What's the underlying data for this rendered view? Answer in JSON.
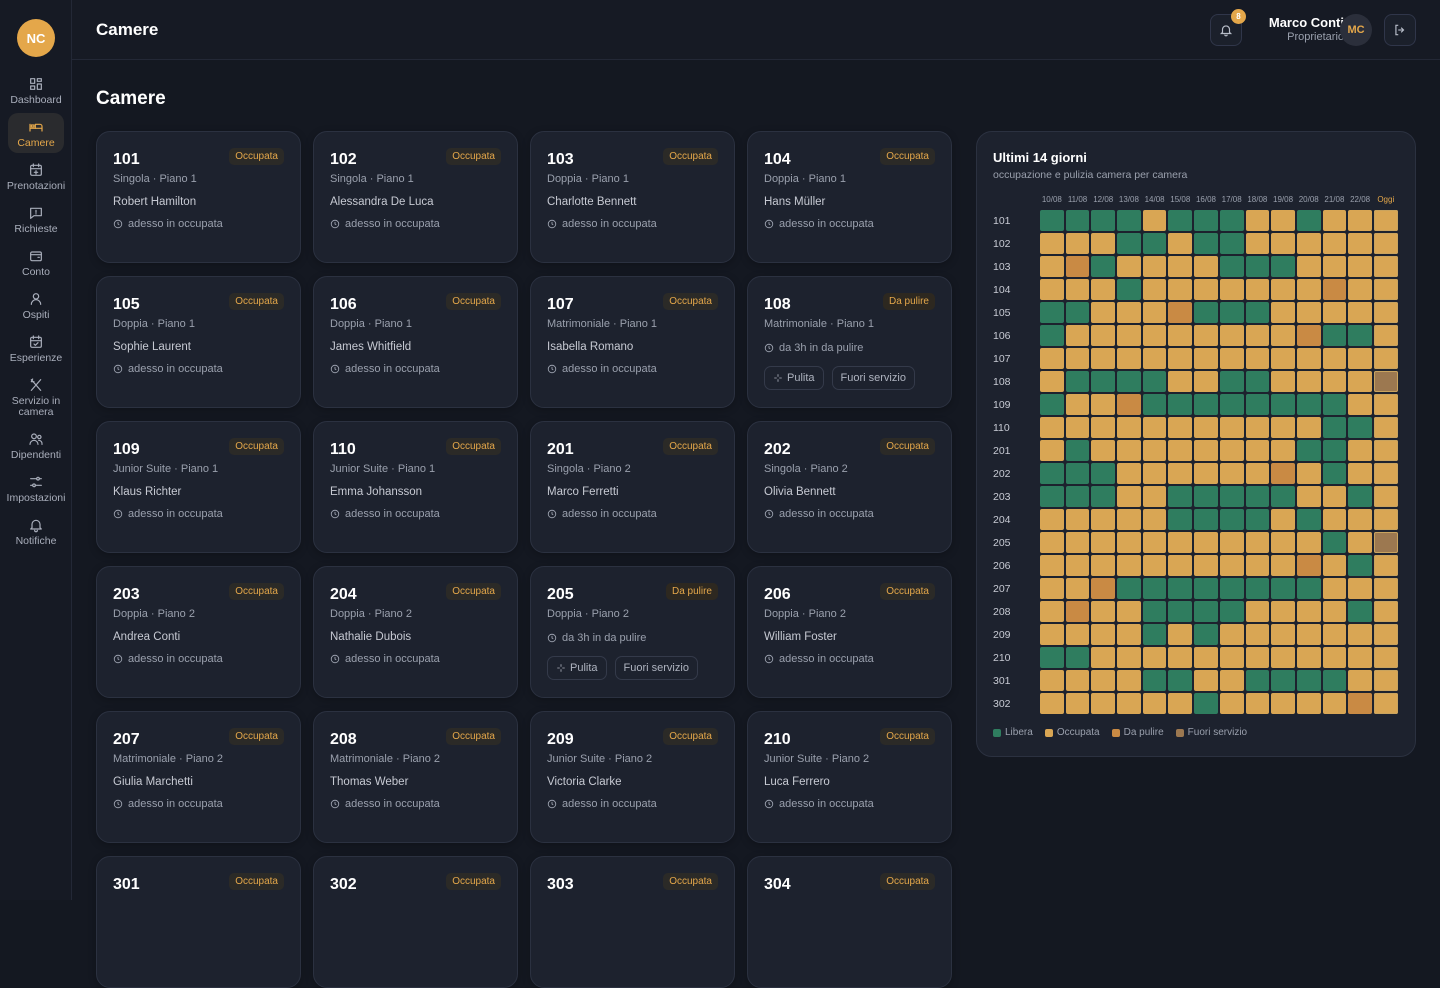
{
  "app": {
    "logo": "NC",
    "header_title": "Camere",
    "page_title": "Camere"
  },
  "user": {
    "name": "Marco Conti",
    "role": "Proprietario",
    "initials": "MC",
    "notifications": "8"
  },
  "nav": [
    {
      "label": "Dashboard",
      "icon": "dashboard-icon"
    },
    {
      "label": "Camere",
      "icon": "bed-icon",
      "active": true
    },
    {
      "label": "Prenotazioni",
      "icon": "calendar-plus-icon"
    },
    {
      "label": "Richieste",
      "icon": "message-icon"
    },
    {
      "label": "Conto",
      "icon": "wallet-icon"
    },
    {
      "label": "Ospiti",
      "icon": "user-icon"
    },
    {
      "label": "Esperienze",
      "icon": "calendar-check-icon"
    },
    {
      "label": "Servizio in camera",
      "icon": "cutlery-icon"
    },
    {
      "label": "Dipendenti",
      "icon": "users-icon"
    },
    {
      "label": "Impostazioni",
      "icon": "sliders-icon"
    },
    {
      "label": "Notifiche",
      "icon": "bell-icon"
    }
  ],
  "rooms": [
    {
      "number": "101",
      "type": "Singola · Piano 1",
      "status": "Occupata",
      "guest": "Robert Hamilton",
      "since": "adesso in occupata"
    },
    {
      "number": "102",
      "type": "Singola · Piano 1",
      "status": "Occupata",
      "guest": "Alessandra De Luca",
      "since": "adesso in occupata"
    },
    {
      "number": "103",
      "type": "Doppia · Piano 1",
      "status": "Occupata",
      "guest": "Charlotte Bennett",
      "since": "adesso in occupata"
    },
    {
      "number": "104",
      "type": "Doppia · Piano 1",
      "status": "Occupata",
      "guest": "Hans Müller",
      "since": "adesso in occupata"
    },
    {
      "number": "105",
      "type": "Doppia · Piano 1",
      "status": "Occupata",
      "guest": "Sophie Laurent",
      "since": "adesso in occupata"
    },
    {
      "number": "106",
      "type": "Doppia · Piano 1",
      "status": "Occupata",
      "guest": "James Whitfield",
      "since": "adesso in occupata"
    },
    {
      "number": "107",
      "type": "Matrimoniale · Piano 1",
      "status": "Occupata",
      "guest": "Isabella Romano",
      "since": "adesso in occupata"
    },
    {
      "number": "108",
      "type": "Matrimoniale · Piano 1",
      "status": "Da pulire",
      "guest": "",
      "since": "da 3h in da pulire",
      "actions": [
        "Pulita",
        "Fuori servizio"
      ]
    },
    {
      "number": "109",
      "type": "Junior Suite · Piano 1",
      "status": "Occupata",
      "guest": "Klaus Richter",
      "since": "adesso in occupata"
    },
    {
      "number": "110",
      "type": "Junior Suite · Piano 1",
      "status": "Occupata",
      "guest": "Emma Johansson",
      "since": "adesso in occupata"
    },
    {
      "number": "201",
      "type": "Singola · Piano 2",
      "status": "Occupata",
      "guest": "Marco Ferretti",
      "since": "adesso in occupata"
    },
    {
      "number": "202",
      "type": "Singola · Piano 2",
      "status": "Occupata",
      "guest": "Olivia Bennett",
      "since": "adesso in occupata"
    },
    {
      "number": "203",
      "type": "Doppia · Piano 2",
      "status": "Occupata",
      "guest": "Andrea Conti",
      "since": "adesso in occupata"
    },
    {
      "number": "204",
      "type": "Doppia · Piano 2",
      "status": "Occupata",
      "guest": "Nathalie Dubois",
      "since": "adesso in occupata"
    },
    {
      "number": "205",
      "type": "Doppia · Piano 2",
      "status": "Da pulire",
      "guest": "",
      "since": "da 3h in da pulire",
      "actions": [
        "Pulita",
        "Fuori servizio"
      ]
    },
    {
      "number": "206",
      "type": "Doppia · Piano 2",
      "status": "Occupata",
      "guest": "William Foster",
      "since": "adesso in occupata"
    },
    {
      "number": "207",
      "type": "Matrimoniale · Piano 2",
      "status": "Occupata",
      "guest": "Giulia Marchetti",
      "since": "adesso in occupata"
    },
    {
      "number": "208",
      "type": "Matrimoniale · Piano 2",
      "status": "Occupata",
      "guest": "Thomas Weber",
      "since": "adesso in occupata"
    },
    {
      "number": "209",
      "type": "Junior Suite · Piano 2",
      "status": "Occupata",
      "guest": "Victoria Clarke",
      "since": "adesso in occupata"
    },
    {
      "number": "210",
      "type": "Junior Suite · Piano 2",
      "status": "Occupata",
      "guest": "Luca Ferrero",
      "since": "adesso in occupata"
    },
    {
      "number": "301",
      "type": "",
      "status": "Occupata",
      "guest": "",
      "since": ""
    },
    {
      "number": "302",
      "type": "",
      "status": "Occupata",
      "guest": "",
      "since": ""
    },
    {
      "number": "303",
      "type": "",
      "status": "Occupata",
      "guest": "",
      "since": ""
    },
    {
      "number": "304",
      "type": "",
      "status": "Occupata",
      "guest": "",
      "since": ""
    }
  ],
  "history": {
    "title": "Ultimi 14 giorni",
    "subtitle": "occupazione e pulizia camera per camera",
    "dates": [
      "10/08",
      "11/08",
      "12/08",
      "13/08",
      "14/08",
      "15/08",
      "16/08",
      "17/08",
      "18/08",
      "19/08",
      "20/08",
      "21/08",
      "22/08",
      "Oggi"
    ],
    "colors": {
      "L": "#2f7d5f",
      "O": "#d9a654",
      "D": "#c98a44",
      "F": "#9c7850"
    },
    "legend": [
      {
        "label": "Libera",
        "key": "L"
      },
      {
        "label": "Occupata",
        "key": "O"
      },
      {
        "label": "Da pulire",
        "key": "D"
      },
      {
        "label": "Fuori servizio",
        "key": "F"
      }
    ],
    "rows": [
      {
        "room": "101",
        "cells": "LLLLOLLLOOLOOO"
      },
      {
        "room": "102",
        "cells": "OOOLLOLLOOOOOO"
      },
      {
        "room": "103",
        "cells": "ODLOOOOLLLOOOO"
      },
      {
        "room": "104",
        "cells": "OOOLOOOOOOODOO"
      },
      {
        "room": "105",
        "cells": "LLOOODLLLOOOOO"
      },
      {
        "room": "106",
        "cells": "LOOOOOOOOODLLO"
      },
      {
        "room": "107",
        "cells": "OOOOOOOOOOOOOO"
      },
      {
        "room": "108",
        "cells": "OLLLLOOLLOOOOF"
      },
      {
        "room": "109",
        "cells": "LOODLLLLLLLLOO"
      },
      {
        "room": "110",
        "cells": "OOOOOOOOOOOLLO"
      },
      {
        "room": "201",
        "cells": "OLOOOOOOOOLLOO"
      },
      {
        "room": "202",
        "cells": "LLLOOOOOODOLOO"
      },
      {
        "room": "203",
        "cells": "LLLOOLLLLLOOLO"
      },
      {
        "room": "204",
        "cells": "OOOOOLLLLOLOOO"
      },
      {
        "room": "205",
        "cells": "OOOOOOOOOOOLOF"
      },
      {
        "room": "206",
        "cells": "OOOOOOOOOODOLO"
      },
      {
        "room": "207",
        "cells": "OODLLLLLLLLOOO"
      },
      {
        "room": "208",
        "cells": "ODOOLLLLOOOOLO"
      },
      {
        "room": "209",
        "cells": "OOOOLOLOOOOOOO"
      },
      {
        "room": "210",
        "cells": "LLOOOOOOOOOOOO"
      },
      {
        "room": "301",
        "cells": "OOOOLLOOLLLLOO"
      },
      {
        "room": "302",
        "cells": "OOOOOOLOOOOODO"
      }
    ]
  }
}
